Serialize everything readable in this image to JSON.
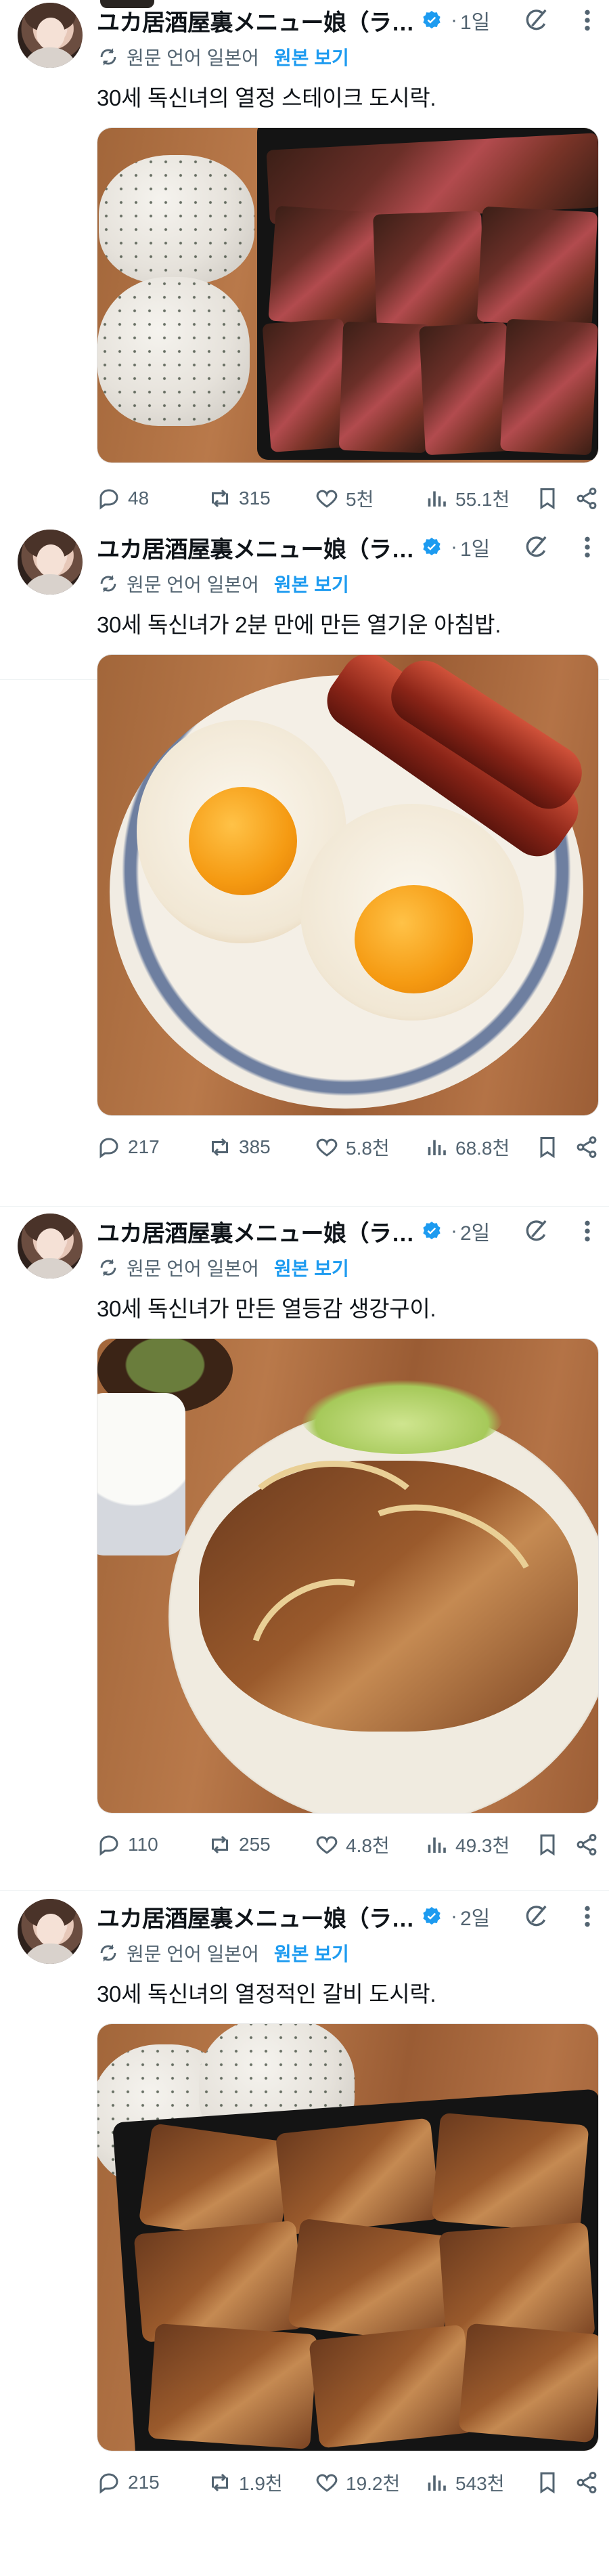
{
  "tweets": [
    {
      "author": "ユカ居酒屋裏メニュー娘（ラ…",
      "separator": "·",
      "time": "1일",
      "translated_label": "원문 언어 일본어",
      "show_original": "원본 보기",
      "text": "30세 독신녀의 열정 스테이크 도시락.",
      "replies": "48",
      "retweets": "315",
      "likes": "5천",
      "views": "55.1천"
    },
    {
      "author": "ユカ居酒屋裏メニュー娘（ラ…",
      "separator": "·",
      "time": "1일",
      "translated_label": "원문 언어 일본어",
      "show_original": "원본 보기",
      "text": "30세 독신녀가 2분 만에 만든 열기운 아침밥.",
      "replies": "217",
      "retweets": "385",
      "likes": "5.8천",
      "views": "68.8천"
    },
    {
      "author": "ユカ居酒屋裏メニュー娘（ラ…",
      "separator": "·",
      "time": "2일",
      "translated_label": "원문 언어 일본어",
      "show_original": "원본 보기",
      "text": "30세 독신녀가 만든 열등감 생강구이.",
      "replies": "110",
      "retweets": "255",
      "likes": "4.8천",
      "views": "49.3천"
    },
    {
      "author": "ユカ居酒屋裏メニュー娘（ラ…",
      "separator": "·",
      "time": "2일",
      "translated_label": "원문 언어 일본어",
      "show_original": "원본 보기",
      "text": "30세 독신녀의 열정적인 갈비 도시락.",
      "replies": "215",
      "retweets": "1.9천",
      "likes": "19.2천",
      "views": "543천"
    }
  ],
  "colors": {
    "accent": "#1d9bf0",
    "muted": "#536471",
    "text": "#0f1419"
  }
}
